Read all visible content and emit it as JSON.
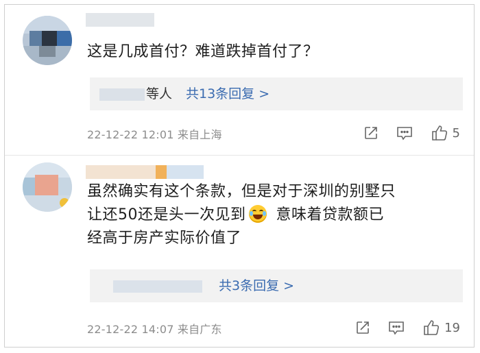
{
  "comments": [
    {
      "text": "这是几成首付？难道跌掉首付了？",
      "reply_suffix": "等人",
      "reply_link": "共13条回复 >",
      "timestamp": "22-12-22 12:01 来自上海",
      "likes": "5"
    },
    {
      "text_line1": "虽然确实有这个条款，但是对于深圳的别墅只",
      "text_line2a": "让还50还是头一次见到",
      "text_line2b": "意味着贷款额已",
      "text_line3": "经高于房产实际价值了",
      "reply_link": "共3条回复 >",
      "timestamp": "22-12-22 14:07 来自广东",
      "likes": "19"
    }
  ],
  "icons": {
    "share": "share-icon",
    "comment": "comment-icon",
    "like": "like-icon",
    "emoji": "laugh-cry-emoji-icon"
  },
  "colors": {
    "link": "#3a6bb0",
    "meta": "#8c8c8c",
    "reply_bg": "#f2f2f2"
  }
}
